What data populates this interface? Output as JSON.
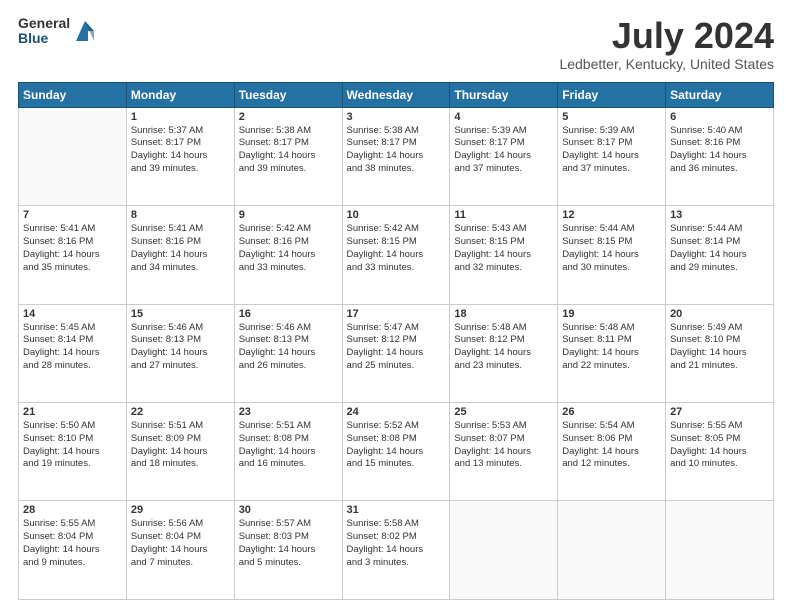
{
  "logo": {
    "general": "General",
    "blue": "Blue"
  },
  "header": {
    "title": "July 2024",
    "subtitle": "Ledbetter, Kentucky, United States"
  },
  "weekdays": [
    "Sunday",
    "Monday",
    "Tuesday",
    "Wednesday",
    "Thursday",
    "Friday",
    "Saturday"
  ],
  "weeks": [
    [
      {
        "day": "",
        "info": ""
      },
      {
        "day": "1",
        "info": "Sunrise: 5:37 AM\nSunset: 8:17 PM\nDaylight: 14 hours\nand 39 minutes."
      },
      {
        "day": "2",
        "info": "Sunrise: 5:38 AM\nSunset: 8:17 PM\nDaylight: 14 hours\nand 39 minutes."
      },
      {
        "day": "3",
        "info": "Sunrise: 5:38 AM\nSunset: 8:17 PM\nDaylight: 14 hours\nand 38 minutes."
      },
      {
        "day": "4",
        "info": "Sunrise: 5:39 AM\nSunset: 8:17 PM\nDaylight: 14 hours\nand 37 minutes."
      },
      {
        "day": "5",
        "info": "Sunrise: 5:39 AM\nSunset: 8:17 PM\nDaylight: 14 hours\nand 37 minutes."
      },
      {
        "day": "6",
        "info": "Sunrise: 5:40 AM\nSunset: 8:16 PM\nDaylight: 14 hours\nand 36 minutes."
      }
    ],
    [
      {
        "day": "7",
        "info": "Sunrise: 5:41 AM\nSunset: 8:16 PM\nDaylight: 14 hours\nand 35 minutes."
      },
      {
        "day": "8",
        "info": "Sunrise: 5:41 AM\nSunset: 8:16 PM\nDaylight: 14 hours\nand 34 minutes."
      },
      {
        "day": "9",
        "info": "Sunrise: 5:42 AM\nSunset: 8:16 PM\nDaylight: 14 hours\nand 33 minutes."
      },
      {
        "day": "10",
        "info": "Sunrise: 5:42 AM\nSunset: 8:15 PM\nDaylight: 14 hours\nand 33 minutes."
      },
      {
        "day": "11",
        "info": "Sunrise: 5:43 AM\nSunset: 8:15 PM\nDaylight: 14 hours\nand 32 minutes."
      },
      {
        "day": "12",
        "info": "Sunrise: 5:44 AM\nSunset: 8:15 PM\nDaylight: 14 hours\nand 30 minutes."
      },
      {
        "day": "13",
        "info": "Sunrise: 5:44 AM\nSunset: 8:14 PM\nDaylight: 14 hours\nand 29 minutes."
      }
    ],
    [
      {
        "day": "14",
        "info": "Sunrise: 5:45 AM\nSunset: 8:14 PM\nDaylight: 14 hours\nand 28 minutes."
      },
      {
        "day": "15",
        "info": "Sunrise: 5:46 AM\nSunset: 8:13 PM\nDaylight: 14 hours\nand 27 minutes."
      },
      {
        "day": "16",
        "info": "Sunrise: 5:46 AM\nSunset: 8:13 PM\nDaylight: 14 hours\nand 26 minutes."
      },
      {
        "day": "17",
        "info": "Sunrise: 5:47 AM\nSunset: 8:12 PM\nDaylight: 14 hours\nand 25 minutes."
      },
      {
        "day": "18",
        "info": "Sunrise: 5:48 AM\nSunset: 8:12 PM\nDaylight: 14 hours\nand 23 minutes."
      },
      {
        "day": "19",
        "info": "Sunrise: 5:48 AM\nSunset: 8:11 PM\nDaylight: 14 hours\nand 22 minutes."
      },
      {
        "day": "20",
        "info": "Sunrise: 5:49 AM\nSunset: 8:10 PM\nDaylight: 14 hours\nand 21 minutes."
      }
    ],
    [
      {
        "day": "21",
        "info": "Sunrise: 5:50 AM\nSunset: 8:10 PM\nDaylight: 14 hours\nand 19 minutes."
      },
      {
        "day": "22",
        "info": "Sunrise: 5:51 AM\nSunset: 8:09 PM\nDaylight: 14 hours\nand 18 minutes."
      },
      {
        "day": "23",
        "info": "Sunrise: 5:51 AM\nSunset: 8:08 PM\nDaylight: 14 hours\nand 16 minutes."
      },
      {
        "day": "24",
        "info": "Sunrise: 5:52 AM\nSunset: 8:08 PM\nDaylight: 14 hours\nand 15 minutes."
      },
      {
        "day": "25",
        "info": "Sunrise: 5:53 AM\nSunset: 8:07 PM\nDaylight: 14 hours\nand 13 minutes."
      },
      {
        "day": "26",
        "info": "Sunrise: 5:54 AM\nSunset: 8:06 PM\nDaylight: 14 hours\nand 12 minutes."
      },
      {
        "day": "27",
        "info": "Sunrise: 5:55 AM\nSunset: 8:05 PM\nDaylight: 14 hours\nand 10 minutes."
      }
    ],
    [
      {
        "day": "28",
        "info": "Sunrise: 5:55 AM\nSunset: 8:04 PM\nDaylight: 14 hours\nand 9 minutes."
      },
      {
        "day": "29",
        "info": "Sunrise: 5:56 AM\nSunset: 8:04 PM\nDaylight: 14 hours\nand 7 minutes."
      },
      {
        "day": "30",
        "info": "Sunrise: 5:57 AM\nSunset: 8:03 PM\nDaylight: 14 hours\nand 5 minutes."
      },
      {
        "day": "31",
        "info": "Sunrise: 5:58 AM\nSunset: 8:02 PM\nDaylight: 14 hours\nand 3 minutes."
      },
      {
        "day": "",
        "info": ""
      },
      {
        "day": "",
        "info": ""
      },
      {
        "day": "",
        "info": ""
      }
    ]
  ]
}
